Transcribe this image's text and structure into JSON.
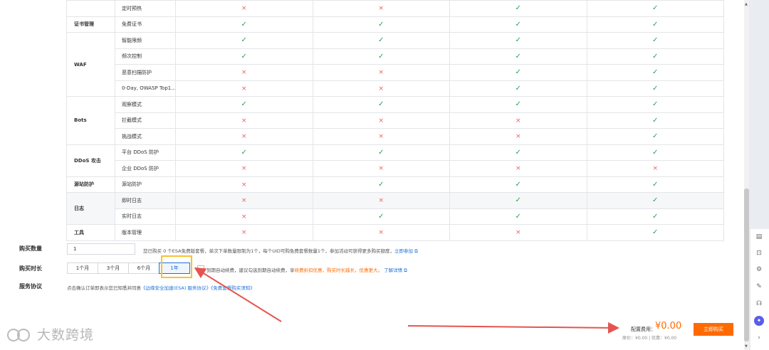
{
  "comparison": {
    "rows": [
      {
        "cat": "",
        "feat": "定时预热",
        "vals": [
          "no",
          "no",
          "yes",
          "yes"
        ]
      },
      {
        "cat": "证书管理",
        "feat": "免费证书",
        "vals": [
          "yes",
          "yes",
          "yes",
          "yes"
        ]
      },
      {
        "cat": "WAF",
        "span": 4,
        "feat": "智能限频",
        "vals": [
          "yes",
          "yes",
          "yes",
          "yes"
        ]
      },
      {
        "feat": "频次控制",
        "vals": [
          "yes",
          "yes",
          "yes",
          "yes"
        ]
      },
      {
        "feat": "恶意扫描防护",
        "vals": [
          "no",
          "no",
          "yes",
          "yes"
        ]
      },
      {
        "feat": "0-Day, OWASP Top1...",
        "vals": [
          "no",
          "no",
          "yes",
          "yes"
        ]
      },
      {
        "cat": "Bots",
        "span": 3,
        "feat": "观察模式",
        "vals": [
          "yes",
          "yes",
          "yes",
          "yes"
        ]
      },
      {
        "feat": "拦截模式",
        "vals": [
          "no",
          "no",
          "no",
          "yes"
        ]
      },
      {
        "feat": "挑战模式",
        "vals": [
          "no",
          "no",
          "no",
          "yes"
        ]
      },
      {
        "cat": "DDoS 攻击",
        "span": 2,
        "feat": "平台 DDoS 防护",
        "vals": [
          "yes",
          "yes",
          "yes",
          "yes"
        ]
      },
      {
        "feat": "企业 DDoS 防护",
        "vals": [
          "no",
          "no",
          "no",
          "no"
        ]
      },
      {
        "cat": "源站防护",
        "feat": "源站防护",
        "vals": [
          "no",
          "yes",
          "yes",
          "yes"
        ]
      },
      {
        "cat": "日志",
        "span": 2,
        "feat": "即时日志",
        "vals": [
          "no",
          "no",
          "yes",
          "yes"
        ],
        "hl": true
      },
      {
        "feat": "实时日志",
        "vals": [
          "no",
          "yes",
          "yes",
          "yes"
        ]
      },
      {
        "cat": "工具",
        "feat": "版本管理",
        "vals": [
          "no",
          "no",
          "no",
          "yes"
        ]
      }
    ],
    "yes_glyph": "✓",
    "no_glyph": "×"
  },
  "form": {
    "qty_label": "购买数量",
    "qty_value": "1",
    "qty_hint": "您已购买 0 个ESA免费版套餐，单次下单数量限制为1个，每个UID可购免费套餐数量1个，参加活动可获得更多购买额度，",
    "qty_link": "立即参加",
    "duration_label": "购买时长",
    "durations": [
      "1个月",
      "3个月",
      "6个月",
      "1年"
    ],
    "renew_text_1": "到期自动续费，建议勾选到期自动续费，享",
    "renew_text_orange": "续费折扣优惠，购买时长越长，优惠更大。",
    "renew_link": "了解详情",
    "agreement_label": "服务协议",
    "agreement_text": "点击确认订单即表示您已知悉并同意",
    "agreement_link_1": "《边缘安全加速(ESA) 服务协议》",
    "agreement_link_2": "《免费套餐购买须知》"
  },
  "footer": {
    "fee_label": "配置费用：",
    "fee_amount": "¥0.00",
    "fee_sub": "原价：¥0.00 | 优惠：¥0.00",
    "buy_label": "立即购买"
  },
  "watermark": {
    "text": "大数跨境"
  },
  "colors": {
    "accent": "#ff6a00",
    "link": "#1f72d6",
    "yes": "#2e9b5a",
    "no": "#e66262",
    "highlight": "#f7c233",
    "arrow": "#e5544f"
  }
}
